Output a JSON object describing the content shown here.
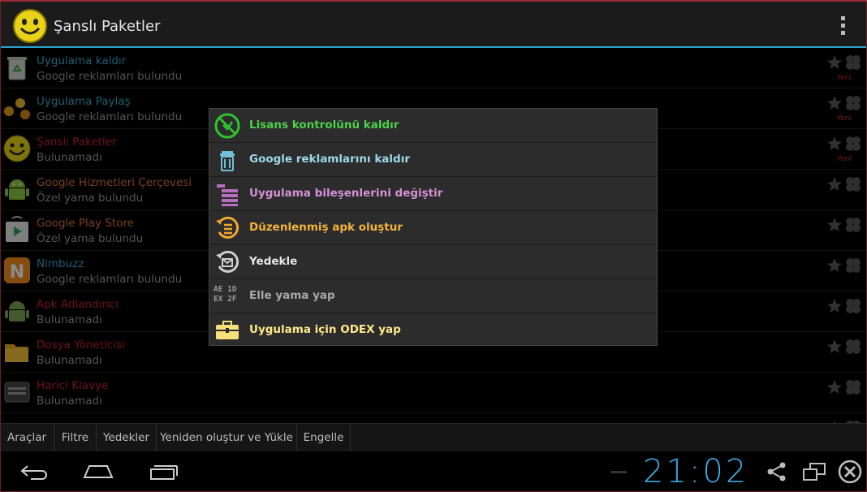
{
  "app": {
    "title": "Şanslı Paketler"
  },
  "list": {
    "rows": [
      {
        "title": "Uygulama kaldır",
        "subtitle": "Google reklamları bulundu",
        "title_color": "#36a9cf",
        "badge": "Yeni",
        "icon": "recycle-bin-icon"
      },
      {
        "title": "Uygulama Paylaş",
        "subtitle": "Google reklamları bulundu",
        "title_color": "#36a9cf",
        "badge": "Yeni",
        "icon": "share-dots-icon"
      },
      {
        "title": "Şanslı Paketler",
        "subtitle": "Bulunamadı",
        "title_color": "#c7203a",
        "badge": "Yeni",
        "icon": "smiley-icon"
      },
      {
        "title": "Google Hizmetleri Çerçevesi",
        "subtitle": "Özel yama bulundu",
        "title_color": "#e0733a",
        "badge": "",
        "icon": "android-icon"
      },
      {
        "title": "Google Play Store",
        "subtitle": "Özel yama bulundu",
        "title_color": "#e0733a",
        "badge": "",
        "icon": "play-store-icon"
      },
      {
        "title": "Nimbuzz",
        "subtitle": "Google reklamları bulundu",
        "title_color": "#36a9cf",
        "badge": "",
        "icon": "nimbuzz-icon"
      },
      {
        "title": "Apk Adlandırıcı",
        "subtitle": "Bulunamadı",
        "title_color": "#c7203a",
        "badge": "",
        "icon": "android-icon"
      },
      {
        "title": "Dosya Yöneticisi",
        "subtitle": "Bulunamadı",
        "title_color": "#c7203a",
        "badge": "",
        "icon": "folder-icon"
      },
      {
        "title": "Harici Klavye",
        "subtitle": "Bulunamadı",
        "title_color": "#c7203a",
        "badge": "",
        "icon": "keyboard-icon"
      }
    ]
  },
  "dialog": {
    "items": [
      {
        "label": "Lisans kontrolünü kaldır",
        "color": "#4cd14c",
        "icon": "license-remove-icon"
      },
      {
        "label": "Google reklamlarını kaldır",
        "color": "#9fd7e8",
        "icon": "trash-icon"
      },
      {
        "label": "Uygulama bileşenlerini değiştir",
        "color": "#d590d6",
        "icon": "components-icon"
      },
      {
        "label": "Düzenlenmiş apk oluştur",
        "color": "#f4b33a",
        "icon": "rebuild-apk-icon"
      },
      {
        "label": "Yedekle",
        "color": "#e6e6e6",
        "icon": "backup-icon"
      },
      {
        "label": "Elle yama yap",
        "color": "#a8a8a8",
        "icon": "hex-icon",
        "icon_text": [
          "AE 1D",
          "EX 2F"
        ]
      },
      {
        "label": "Uygulama için ODEX yap",
        "color": "#ffe88a",
        "icon": "toolbox-icon"
      }
    ]
  },
  "tabs": [
    {
      "label": "Araçlar"
    },
    {
      "label": "Filtre"
    },
    {
      "label": "Yedekler"
    },
    {
      "label": "Yeniden oluştur ve Yükle"
    },
    {
      "label": "Engelle"
    }
  ],
  "statusbar": {
    "clock": "21:02"
  },
  "colors": {
    "accent": "#2aa3c9",
    "new_badge": "#d23030",
    "clock": "#3aa6dd"
  }
}
